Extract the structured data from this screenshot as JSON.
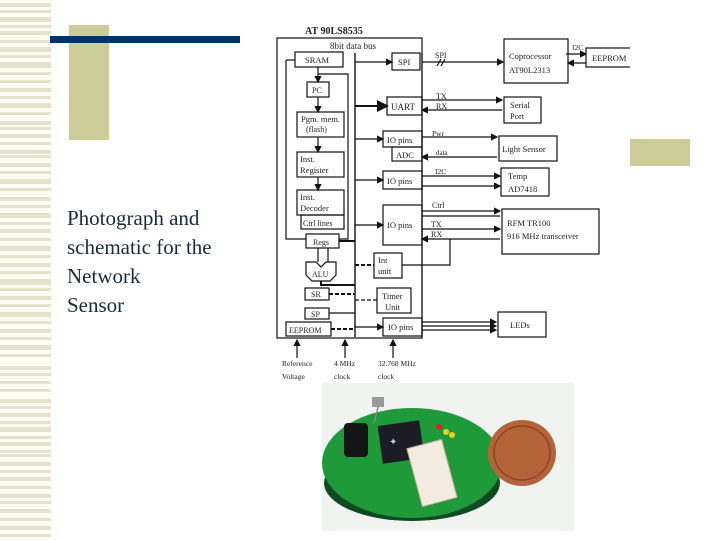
{
  "slide": {
    "caption_lines": [
      "Photograph and",
      "schematic for the",
      "Network",
      "Sensor"
    ]
  },
  "colors": {
    "title_rule": "#003366",
    "accent_khaki": "#cccc99",
    "stripe": "#e4e2cc",
    "board_green": "#1f9a3a",
    "penny_copper": "#b5643a"
  },
  "schematic": {
    "chip_title": "AT 90LS8535",
    "bus_label": "8bit data bus",
    "internal": {
      "sram": "SRAM",
      "pc": "PC",
      "pgm_mem_1": "Pgm. mem.",
      "pgm_mem_2": "(flash)",
      "inst_reg_1": "Inst.",
      "inst_reg_2": "Register",
      "inst_dec_1": "Inst.",
      "inst_dec_2": "Decoder",
      "ctrl_lines": "Ctrl lines",
      "regs": "Regs",
      "alu": "ALU",
      "sr": "SR",
      "sp": "SP",
      "eeprom": "EEPROM",
      "spi": "SPI",
      "uart": "UART",
      "io_pins": "IO pins",
      "adc": "ADC",
      "int_unit_1": "Int",
      "int_unit_2": "unit",
      "timer_1": "Timer",
      "timer_2": "Unit"
    },
    "signals": {
      "spi": "SPI",
      "tx": "TX",
      "rx": "RX",
      "pwr": "Pwr",
      "data": "data",
      "i2c": "I2C",
      "ctrl": "Ctrl"
    },
    "external": {
      "coproc_1": "Coprocessor",
      "coproc_2": "AT90L2313",
      "eeprom": "EEPROM",
      "serial_1": "Serial",
      "serial_2": "Port",
      "light": "Light Sensor",
      "temp_1": "Temp",
      "temp_2": "AD7418",
      "rfm_1": "RFM TR100",
      "rfm_2": "916 MHz transceiver",
      "leds": "LEDs"
    },
    "inputs": {
      "ref_1": "Reference",
      "ref_2": "Voltage",
      "clk4_1": "4 MHz",
      "clk4_2": "clock",
      "clk32_1": "32.768 MHz",
      "clk32_2": "clock"
    }
  },
  "photo": {
    "subject": "Network sensor board next to a penny"
  }
}
